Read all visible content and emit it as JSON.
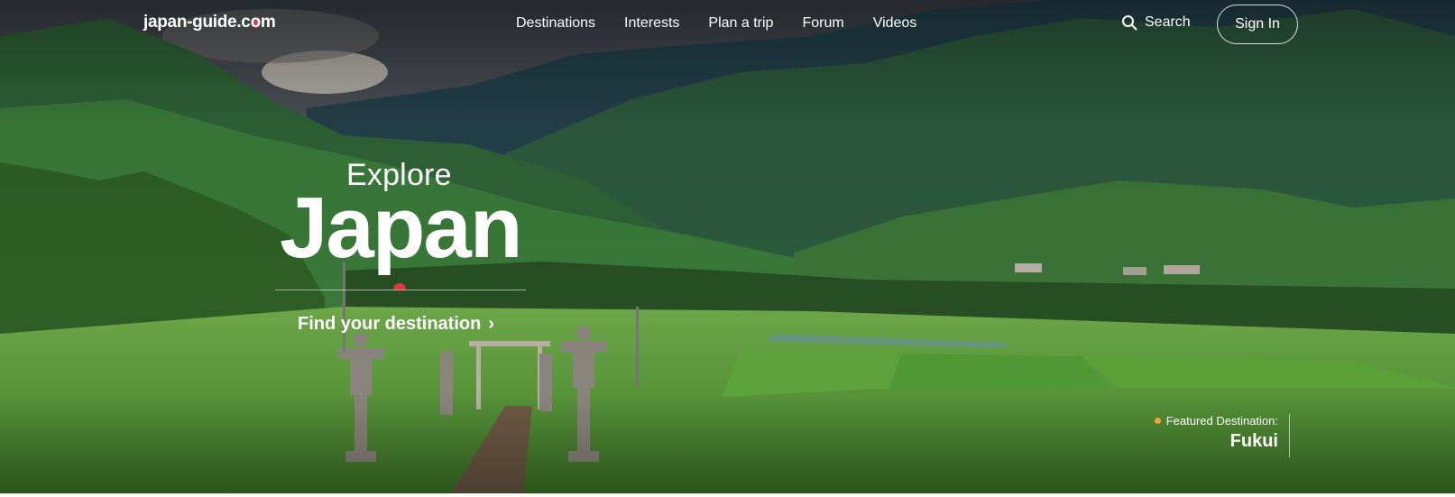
{
  "header": {
    "logo_prefix": "japan-guide.c",
    "logo_o": "o",
    "logo_suffix": "m",
    "nav": [
      "Destinations",
      "Interests",
      "Plan a trip",
      "Forum",
      "Videos"
    ],
    "search_label": "Search",
    "signin_label": "Sign In"
  },
  "hero": {
    "kicker": "Explore",
    "title": "Japan",
    "cta": "Find your destination",
    "featured_label": "Featured Destination:",
    "featured_name": "Fukui"
  },
  "colors": {
    "brand_red": "#e8343f",
    "accent_orange": "#f0a830"
  },
  "icons": {
    "search": "search-icon",
    "chevron": "chevron-right-icon"
  }
}
